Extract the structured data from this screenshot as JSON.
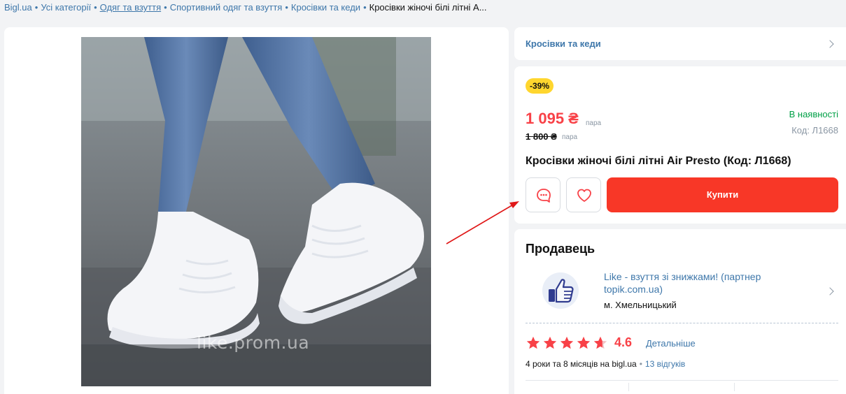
{
  "breadcrumb": {
    "items": [
      "Bigl.ua",
      "Усі категорії",
      "Одяг та взуття",
      "Спортивний одяг та взуття",
      "Кросівки та кеди"
    ],
    "separator": "•",
    "current": "Кросівки жіночі білі літні А..."
  },
  "photo": {
    "watermark": "like.prom.ua"
  },
  "category_link": {
    "label": "Кросівки та кеди"
  },
  "product": {
    "discount": "-39%",
    "price": "1 095 ₴",
    "price_unit": "пара",
    "old_price": "1 800 ₴",
    "old_price_unit": "пара",
    "availability": "В наявності",
    "code": "Код: Л1668",
    "title": "Кросівки жіночі білі літні Air Presto (Код: Л1668)",
    "buy_label": "Купити",
    "icons": {
      "chat": "chat-bubble-icon",
      "favorite": "heart-icon"
    }
  },
  "seller": {
    "heading": "Продавець",
    "name": "Like - взуття зі знижками! (партнер topik.com.ua)",
    "city": "м. Хмельницький",
    "logo_icon": "thumbs-up-icon",
    "rating": "4.6",
    "stars": 4.6,
    "details_link": "Детальніше",
    "tenure": "4 роки та 8 місяців на bigl.ua",
    "reviews": "13 відгуків"
  },
  "colors": {
    "accent_red": "#f84147",
    "buy_button": "#f83727",
    "link_blue": "#3e77aa",
    "in_stock_green": "#00a046",
    "discount_yellow": "#ffd62e"
  }
}
